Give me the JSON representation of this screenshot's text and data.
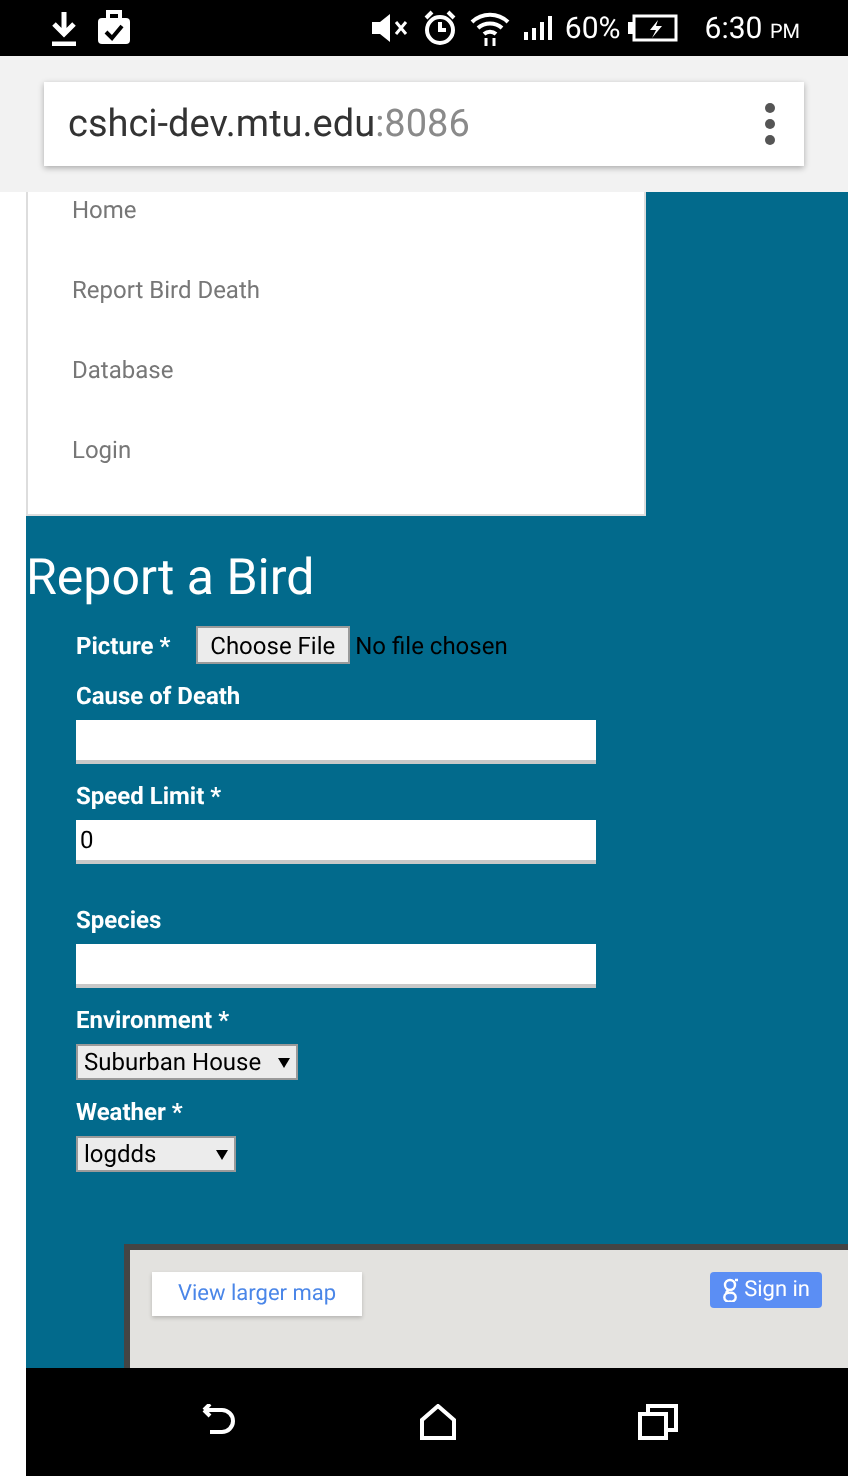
{
  "status_bar": {
    "battery": "60%",
    "time": "6:30",
    "time_suffix": "PM"
  },
  "address_bar": {
    "host": "cshci-dev.mtu.edu",
    "port": ":8086"
  },
  "menu": {
    "items": [
      {
        "label": "Home"
      },
      {
        "label": "Report Bird Death"
      },
      {
        "label": "Database"
      },
      {
        "label": "Login"
      }
    ]
  },
  "form": {
    "title": "Report a Bird",
    "picture": {
      "label": "Picture *",
      "button": "Choose File",
      "status": "No file chosen"
    },
    "fields": [
      {
        "kind": "text",
        "label": "Cause of Death"
      },
      {
        "kind": "text",
        "label": "Speed Limit *",
        "value": "0"
      },
      {
        "kind": "text",
        "label": "Species"
      },
      {
        "kind": "select",
        "label": "Environment *",
        "value": "Suburban House"
      },
      {
        "kind": "select",
        "label": "Weather *",
        "value": "logdds"
      }
    ]
  },
  "map": {
    "view_larger": "View larger map",
    "sign_in": "Sign in"
  }
}
